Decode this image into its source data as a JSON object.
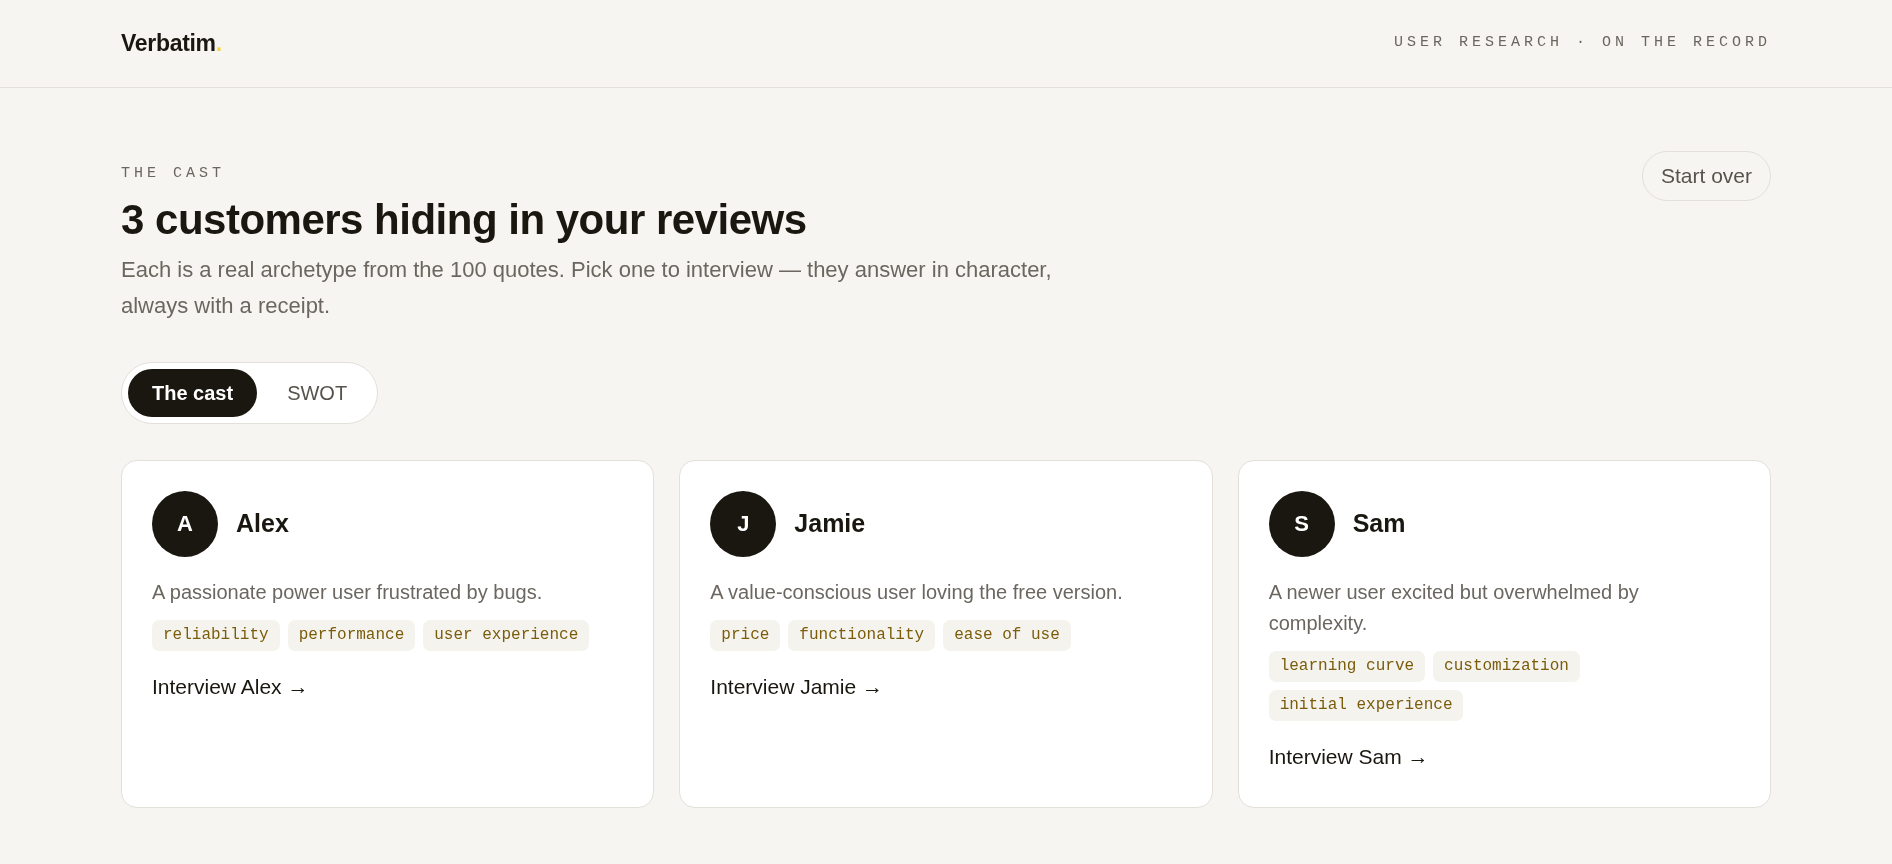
{
  "header": {
    "logo": {
      "name": "Verbatim",
      "mark": "."
    },
    "tagline": "USER RESEARCH · ON THE RECORD"
  },
  "intro": {
    "eyebrow": "THE CAST",
    "title": "3 customers hiding in your reviews",
    "subtitle": "Each is a real archetype from the 100 quotes. Pick one to interview — they answer in character, always with a receipt.",
    "start_over": "Start over"
  },
  "tabs": [
    {
      "label": "The cast",
      "selected": true
    },
    {
      "label": "SWOT",
      "selected": false
    }
  ],
  "personas": [
    {
      "initial": "A",
      "name": "Alex",
      "description": "A passionate power user frustrated by bugs.",
      "tags": [
        "reliability",
        "performance",
        "user experience"
      ],
      "link": "Interview Alex →"
    },
    {
      "initial": "J",
      "name": "Jamie",
      "description": "A value-conscious user loving the free version.",
      "tags": [
        "price",
        "functionality",
        "ease of use"
      ],
      "link": "Interview Jamie →"
    },
    {
      "initial": "S",
      "name": "Sam",
      "description": "A newer user excited but overwhelmed by complexity.",
      "tags": [
        "learning curve",
        "customization",
        "initial experience"
      ],
      "link": "Interview Sam →"
    }
  ]
}
